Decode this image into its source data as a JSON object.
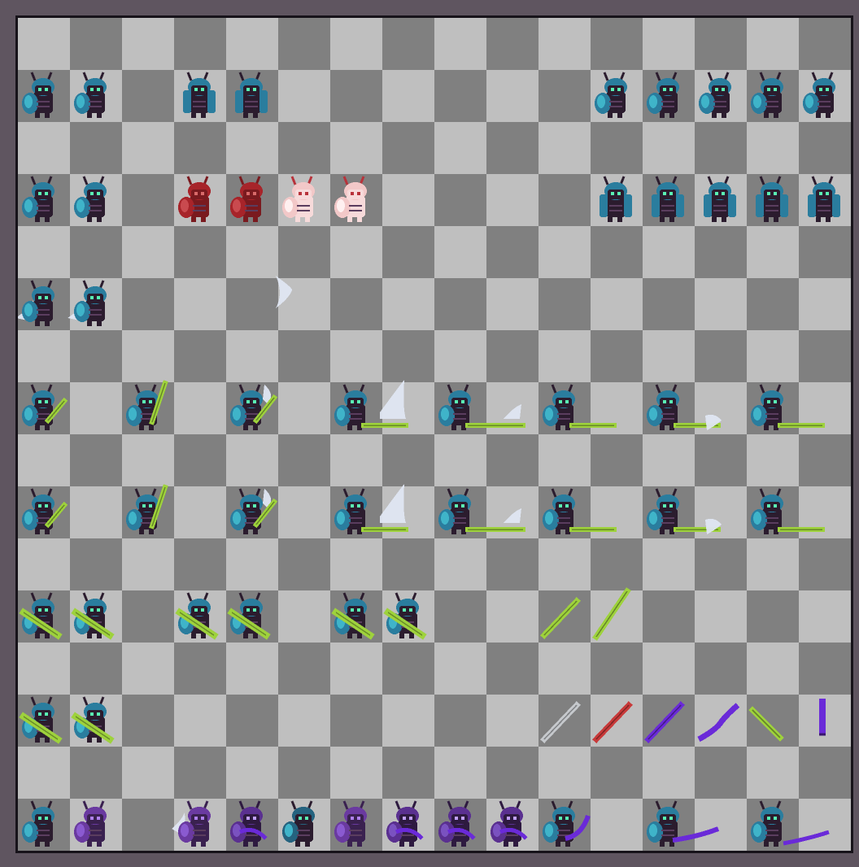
{
  "sheet": {
    "columns": 16,
    "rows": 16,
    "checker_light": "#bfbfbf",
    "checker_dark": "#808080",
    "frame_color": "#5f5560",
    "border_color": "#17131a"
  },
  "palette": {
    "shell": "#2a7d9e",
    "shell_light": "#3fb4c9",
    "body": "#2b1c2e",
    "eye": "#5af2b3",
    "antenna": "#2b1c2e",
    "blade_green": "#9ed23c",
    "blade_green_dark": "#5a7f1e",
    "slash_white": "#dfe6f2",
    "hurt_red": "#a7242a",
    "ghost_pink": "#f2c8c8",
    "ghost_outline": "#b8323a",
    "blade_grey": "#c5c8cc",
    "blade_red": "#c83a3a",
    "blade_purple": "#6a2ad8",
    "blade_purple_dark": "#3a1670"
  },
  "sprite_rows": [
    {
      "name": "idle-row-a",
      "row": 1,
      "frames": [
        {
          "col": 0,
          "kind": "idle-side"
        },
        {
          "col": 1,
          "kind": "idle-side"
        },
        {
          "col": 3,
          "kind": "idle-front"
        },
        {
          "col": 4,
          "kind": "idle-front"
        },
        {
          "col": 11,
          "kind": "idle-side"
        },
        {
          "col": 12,
          "kind": "idle-side"
        },
        {
          "col": 13,
          "kind": "idle-side"
        },
        {
          "col": 14,
          "kind": "idle-side"
        },
        {
          "col": 15,
          "kind": "idle-side"
        }
      ]
    },
    {
      "name": "idle-row-b",
      "row": 3,
      "frames": [
        {
          "col": 0,
          "kind": "idle-side"
        },
        {
          "col": 1,
          "kind": "idle-side"
        },
        {
          "col": 3,
          "kind": "hurt-red"
        },
        {
          "col": 4,
          "kind": "hurt-red"
        },
        {
          "col": 5,
          "kind": "ghost-pink"
        },
        {
          "col": 6,
          "kind": "ghost-pink"
        },
        {
          "col": 11,
          "kind": "idle-front"
        },
        {
          "col": 12,
          "kind": "idle-front"
        },
        {
          "col": 13,
          "kind": "idle-front"
        },
        {
          "col": 14,
          "kind": "idle-front"
        },
        {
          "col": 15,
          "kind": "idle-front"
        }
      ]
    },
    {
      "name": "dash-row",
      "row": 5,
      "frames": [
        {
          "col": 0,
          "kind": "dash"
        },
        {
          "col": 1,
          "kind": "dash"
        },
        {
          "col": 5,
          "kind": "slash-fx"
        }
      ]
    },
    {
      "name": "attack-row-a",
      "row": 7,
      "frames": [
        {
          "col": 0,
          "kind": "attack-diag"
        },
        {
          "col": 2,
          "kind": "attack-up"
        },
        {
          "col": 4,
          "kind": "attack-up-fx"
        },
        {
          "col": 6,
          "kind": "attack-thrust-fx"
        },
        {
          "col": 8,
          "kind": "attack-thrust-fx-small"
        },
        {
          "col": 10,
          "kind": "attack-thrust"
        },
        {
          "col": 12,
          "kind": "attack-thrust-fx-tip"
        },
        {
          "col": 14,
          "kind": "attack-thrust"
        }
      ]
    },
    {
      "name": "attack-row-b",
      "row": 9,
      "frames": [
        {
          "col": 0,
          "kind": "attack-diag"
        },
        {
          "col": 2,
          "kind": "attack-up"
        },
        {
          "col": 4,
          "kind": "attack-up-fx"
        },
        {
          "col": 6,
          "kind": "attack-thrust-fx"
        },
        {
          "col": 8,
          "kind": "attack-thrust-fx-small"
        },
        {
          "col": 10,
          "kind": "attack-thrust"
        },
        {
          "col": 12,
          "kind": "attack-thrust-fx-tip"
        },
        {
          "col": 14,
          "kind": "attack-thrust"
        }
      ]
    },
    {
      "name": "guard-row-a",
      "row": 11,
      "frames": [
        {
          "col": 0,
          "kind": "guard"
        },
        {
          "col": 1,
          "kind": "guard"
        },
        {
          "col": 3,
          "kind": "guard"
        },
        {
          "col": 4,
          "kind": "guard"
        },
        {
          "col": 6,
          "kind": "guard"
        },
        {
          "col": 7,
          "kind": "guard"
        },
        {
          "col": 10,
          "kind": "sword-green"
        },
        {
          "col": 11,
          "kind": "sword-green-long"
        }
      ]
    },
    {
      "name": "guard-row-b",
      "row": 13,
      "frames": [
        {
          "col": 0,
          "kind": "guard"
        },
        {
          "col": 1,
          "kind": "guard"
        },
        {
          "col": 10,
          "kind": "sword-grey"
        },
        {
          "col": 11,
          "kind": "sword-red"
        },
        {
          "col": 12,
          "kind": "sword-purple"
        },
        {
          "col": 13,
          "kind": "sword-purple-curved"
        },
        {
          "col": 14,
          "kind": "sword-green-short"
        },
        {
          "col": 15,
          "kind": "sword-purple-upright"
        }
      ]
    },
    {
      "name": "death-row",
      "row": 15,
      "frames": [
        {
          "col": 0,
          "kind": "idle-side"
        },
        {
          "col": 1,
          "kind": "purple-crouch"
        },
        {
          "col": 3,
          "kind": "purple-burst"
        },
        {
          "col": 4,
          "kind": "purple-claw"
        },
        {
          "col": 5,
          "kind": "idle-side-dark"
        },
        {
          "col": 6,
          "kind": "purple-crouch"
        },
        {
          "col": 7,
          "kind": "purple-claw"
        },
        {
          "col": 8,
          "kind": "purple-claw"
        },
        {
          "col": 9,
          "kind": "purple-claw"
        },
        {
          "col": 10,
          "kind": "scythe-a"
        },
        {
          "col": 12,
          "kind": "scythe-b"
        },
        {
          "col": 14,
          "kind": "scythe-c"
        }
      ]
    }
  ]
}
